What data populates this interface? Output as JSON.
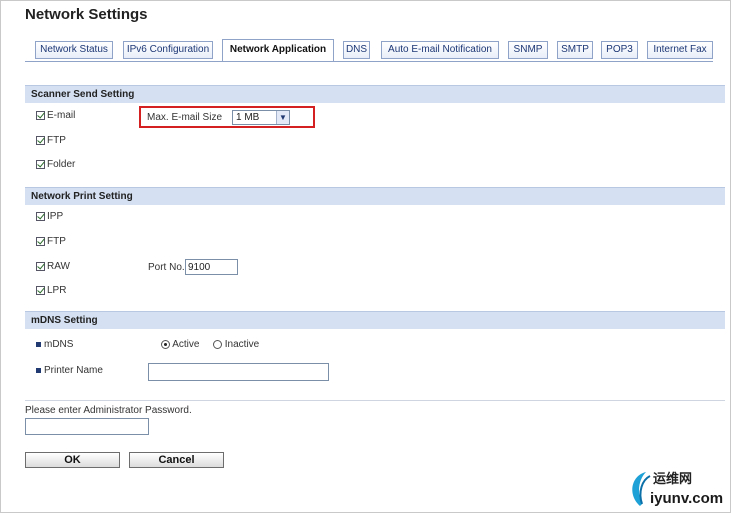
{
  "page": {
    "title": "Network Settings"
  },
  "tabs": [
    {
      "label": "Network Status"
    },
    {
      "label": "IPv6 Configuration"
    },
    {
      "label": "Network Application",
      "active": true
    },
    {
      "label": "DNS"
    },
    {
      "label": "Auto E-mail Notification"
    },
    {
      "label": "SNMP"
    },
    {
      "label": "SMTP"
    },
    {
      "label": "POP3"
    },
    {
      "label": "Internet Fax"
    }
  ],
  "scanner_send": {
    "header": "Scanner Send Setting",
    "email": {
      "label": "E-mail",
      "checked": true
    },
    "ftp": {
      "label": "FTP",
      "checked": true
    },
    "folder": {
      "label": "Folder",
      "checked": true
    },
    "max_email_size": {
      "label": "Max. E-mail Size",
      "value": "1 MB"
    }
  },
  "network_print": {
    "header": "Network Print Setting",
    "ipp": {
      "label": "IPP",
      "checked": true
    },
    "ftp": {
      "label": "FTP",
      "checked": true
    },
    "raw": {
      "label": "RAW",
      "checked": true
    },
    "lpr": {
      "label": "LPR",
      "checked": true
    },
    "port": {
      "label": "Port No.",
      "value": "9100"
    }
  },
  "mdns": {
    "header": "mDNS Setting",
    "mdns_label": "mDNS",
    "active_label": "Active",
    "inactive_label": "Inactive",
    "selected": "Active",
    "printer_name_label": "Printer Name",
    "printer_name_value": ""
  },
  "admin": {
    "password_prompt": "Please enter Administrator Password.",
    "password_value": ""
  },
  "buttons": {
    "ok": "OK",
    "cancel": "Cancel"
  },
  "watermark": {
    "text_cn": "运维网",
    "text_url": "iyunv.com"
  },
  "colors": {
    "highlight": "#d42020",
    "section_bg": "#d5e1f3",
    "tab_border": "#8fa3c8"
  }
}
